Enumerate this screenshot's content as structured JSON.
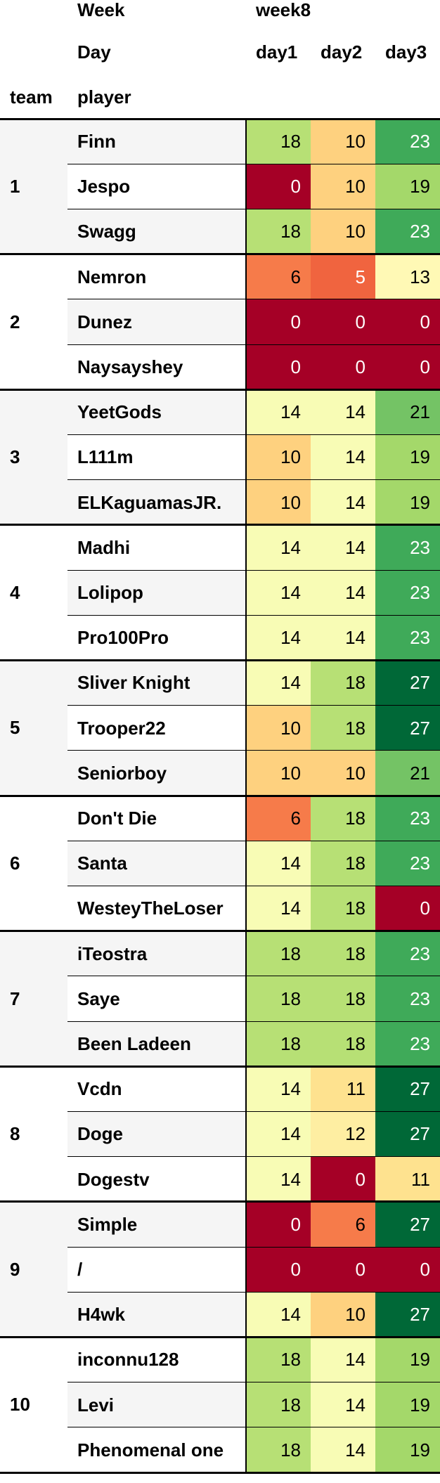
{
  "chart_data": {
    "type": "table",
    "header": {
      "week_label": "Week",
      "week_value": "week8",
      "day_label": "Day",
      "days": [
        "day1",
        "day2",
        "day3"
      ],
      "team_label": "team",
      "player_label": "player"
    },
    "teams": [
      {
        "team": "1",
        "players": [
          {
            "name": "Finn",
            "values": [
              18,
              10,
              23
            ]
          },
          {
            "name": "Jespo",
            "values": [
              0,
              10,
              19
            ]
          },
          {
            "name": "Swagg",
            "values": [
              18,
              10,
              23
            ]
          }
        ]
      },
      {
        "team": "2",
        "players": [
          {
            "name": "Nemron",
            "values": [
              6,
              5,
              13
            ]
          },
          {
            "name": "Dunez",
            "values": [
              0,
              0,
              0
            ]
          },
          {
            "name": "Naysayshey",
            "values": [
              0,
              0,
              0
            ]
          }
        ]
      },
      {
        "team": "3",
        "players": [
          {
            "name": "YeetGods",
            "values": [
              14,
              14,
              21
            ]
          },
          {
            "name": "L111m",
            "values": [
              10,
              14,
              19
            ]
          },
          {
            "name": "ELKaguamasJR.",
            "values": [
              10,
              14,
              19
            ]
          }
        ]
      },
      {
        "team": "4",
        "players": [
          {
            "name": "Madhi",
            "values": [
              14,
              14,
              23
            ]
          },
          {
            "name": "Lolipop",
            "values": [
              14,
              14,
              23
            ]
          },
          {
            "name": "Pro100Pro",
            "values": [
              14,
              14,
              23
            ]
          }
        ]
      },
      {
        "team": "5",
        "players": [
          {
            "name": "Sliver Knight",
            "values": [
              14,
              18,
              27
            ]
          },
          {
            "name": "Trooper22",
            "values": [
              10,
              18,
              27
            ]
          },
          {
            "name": "Seniorboy",
            "values": [
              10,
              10,
              21
            ]
          }
        ]
      },
      {
        "team": "6",
        "players": [
          {
            "name": "Don't Die",
            "values": [
              6,
              18,
              23
            ]
          },
          {
            "name": "Santa",
            "values": [
              14,
              18,
              23
            ]
          },
          {
            "name": "WesteyTheLoser",
            "values": [
              14,
              18,
              0
            ]
          }
        ]
      },
      {
        "team": "7",
        "players": [
          {
            "name": "iTeostra",
            "values": [
              18,
              18,
              23
            ]
          },
          {
            "name": "Saye",
            "values": [
              18,
              18,
              23
            ]
          },
          {
            "name": "Been Ladeen",
            "values": [
              18,
              18,
              23
            ]
          }
        ]
      },
      {
        "team": "8",
        "players": [
          {
            "name": "Vcdn",
            "values": [
              14,
              11,
              27
            ]
          },
          {
            "name": "Doge",
            "values": [
              14,
              12,
              27
            ]
          },
          {
            "name": "Dogestv",
            "values": [
              14,
              0,
              11
            ]
          }
        ]
      },
      {
        "team": "9",
        "players": [
          {
            "name": "Simple",
            "values": [
              0,
              6,
              27
            ]
          },
          {
            "name": "/",
            "values": [
              0,
              0,
              0
            ]
          },
          {
            "name": "H4wk",
            "values": [
              14,
              10,
              27
            ]
          }
        ]
      },
      {
        "team": "10",
        "players": [
          {
            "name": "inconnu128",
            "values": [
              18,
              14,
              19
            ]
          },
          {
            "name": "Levi",
            "values": [
              18,
              14,
              19
            ]
          },
          {
            "name": "Phenomenal one",
            "values": [
              18,
              14,
              19
            ]
          }
        ]
      }
    ],
    "colorscale": {
      "name": "RdYlGn",
      "stops": [
        "#a50026",
        "#d73027",
        "#f46d43",
        "#fdae61",
        "#fee08b",
        "#ffffbf",
        "#d9ef8b",
        "#a6d96a",
        "#66bd63",
        "#1a9850",
        "#006837"
      ]
    }
  }
}
